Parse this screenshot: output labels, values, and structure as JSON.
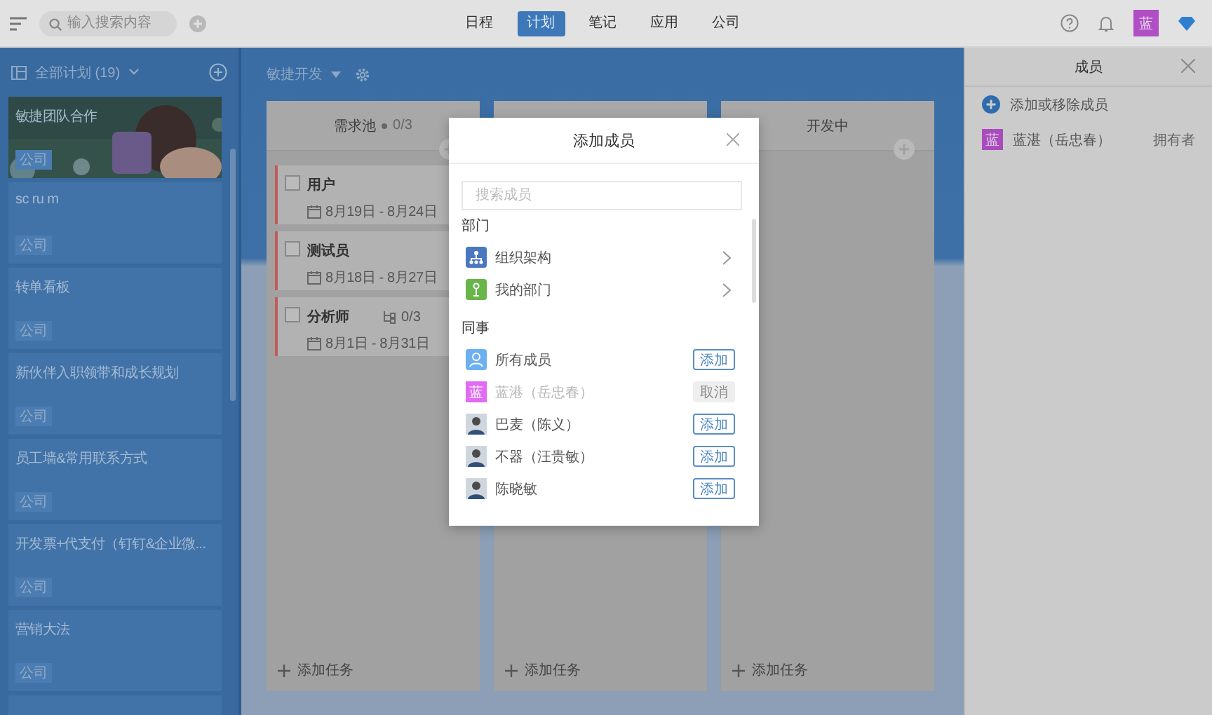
{
  "topbar": {
    "search": {
      "placeholder": "输入搜索内容"
    },
    "nav": [
      {
        "label": "日程",
        "selected": false
      },
      {
        "label": "计划",
        "selected": true
      },
      {
        "label": "笔记",
        "selected": false
      },
      {
        "label": "应用",
        "selected": false
      },
      {
        "label": "公司",
        "selected": false
      }
    ],
    "user_avatar": "蓝"
  },
  "sidebar": {
    "title": "全部计划 (19)",
    "plans": [
      {
        "name": "敏捷团队合作",
        "tag": "公司",
        "kind": "picture"
      },
      {
        "name": "sc ru m",
        "tag": "公司",
        "kind": "plain"
      },
      {
        "name": "转单看板",
        "tag": "公司",
        "kind": "plain"
      },
      {
        "name": "新伙伴入职领带和成长规划",
        "tag": "公司",
        "kind": "plain"
      },
      {
        "name": "员工墙&常用联系方式",
        "tag": "公司",
        "kind": "plain"
      },
      {
        "name": "开发票+代支付（钉钉&企业微...",
        "tag": "公司",
        "kind": "plain"
      },
      {
        "name": "营销大法",
        "tag": "公司",
        "kind": "plain"
      }
    ]
  },
  "board": {
    "project": "敏捷开发",
    "columns": [
      {
        "title": "需求池",
        "count": "0/3",
        "add_label": "添加任务",
        "add_icon": true,
        "tasks": [
          {
            "title": "用户",
            "dates": "8月19日 - 8月24日",
            "checked": false
          },
          {
            "title": "测试员",
            "dates": "8月18日 - 8月27日",
            "checked": false
          },
          {
            "title": "分析师",
            "dates": "8月1日 - 8月31日",
            "subtasks": "0/3",
            "checked": false
          }
        ]
      },
      {
        "add_label": "添加任务"
      },
      {
        "title": "开发中",
        "add_label": "添加任务",
        "add_icon": true
      }
    ]
  },
  "members_panel": {
    "title": "成员",
    "add_label": "添加或移除成员",
    "members": [
      {
        "avatar": "蓝",
        "name": "蓝湛（岳忠春）",
        "role": "拥有者"
      }
    ]
  },
  "dialog": {
    "title": "添加成员",
    "search": {
      "placeholder": "搜索成员"
    },
    "sections": [
      {
        "heading": "部门",
        "items": [
          {
            "name": "组织架构",
            "kind": "org"
          },
          {
            "name": "我的部门",
            "kind": "dept"
          }
        ]
      },
      {
        "heading": "同事",
        "items": [
          {
            "name": "所有成员",
            "kind": "all",
            "action": "添加",
            "disabled": false
          },
          {
            "name": "蓝港（岳忠春）",
            "kind": "initial",
            "avatar": "蓝",
            "action": "取消",
            "disabled": true
          },
          {
            "name": "巴麦（陈义）",
            "action": "添加",
            "disabled": false
          },
          {
            "name": "不器（汪贵敏）",
            "action": "添加",
            "disabled": false
          },
          {
            "name": "陈晓敏",
            "action": "添加",
            "disabled": false
          }
        ]
      }
    ]
  }
}
